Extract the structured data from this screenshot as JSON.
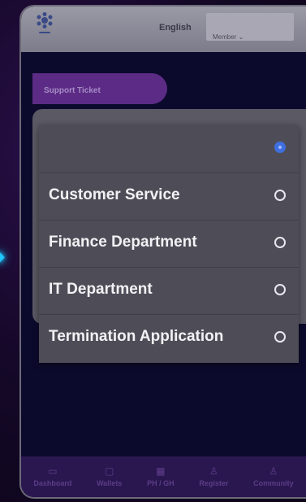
{
  "header": {
    "language": "English",
    "account_menu": "Member",
    "account_menu_icon": "chevron-down-icon"
  },
  "page": {
    "tab_label": "Support Ticket"
  },
  "dropdown": {
    "selected_index": 0,
    "options": [
      {
        "label": ""
      },
      {
        "label": "Customer Service"
      },
      {
        "label": "Finance Department"
      },
      {
        "label": "IT Department"
      },
      {
        "label": "Termination Application"
      }
    ]
  },
  "bottom_nav": {
    "items": [
      {
        "label": "Dashboard",
        "icon": "dashboard-icon"
      },
      {
        "label": "Wallets",
        "icon": "wallet-icon"
      },
      {
        "label": "PH / GH",
        "icon": "grid-icon"
      },
      {
        "label": "Register",
        "icon": "add-user-icon"
      },
      {
        "label": "Community",
        "icon": "community-icon"
      }
    ]
  },
  "colors": {
    "accent": "#5b2b86",
    "selected_radio": "#3f6fe0",
    "arrow": "#1fc8ff"
  }
}
